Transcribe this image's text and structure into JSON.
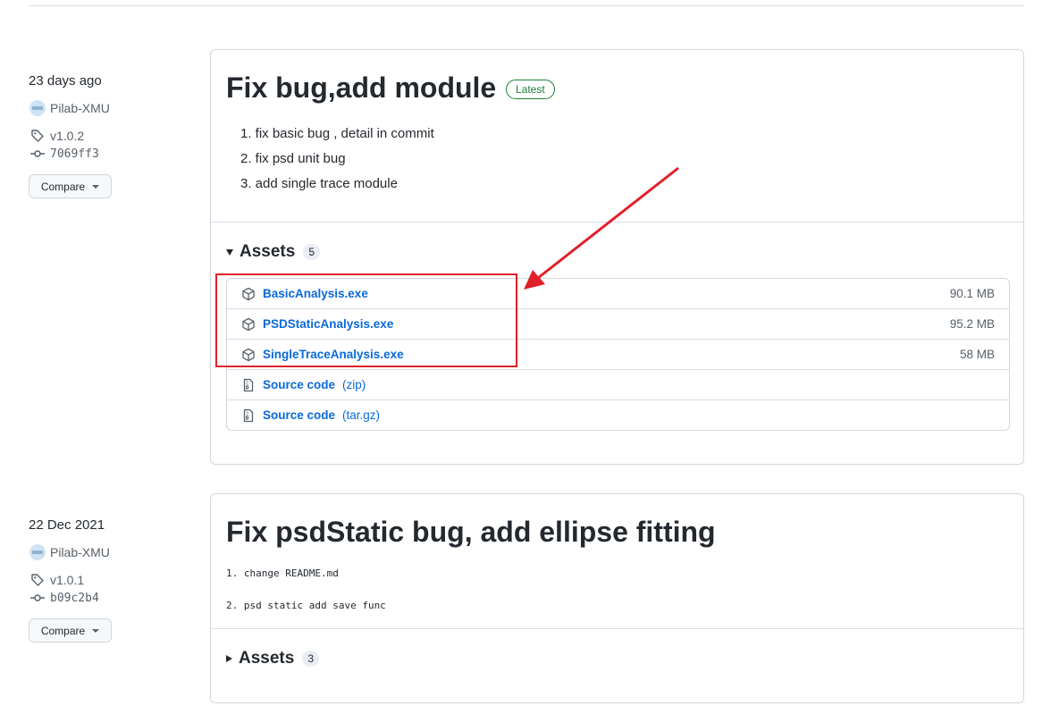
{
  "releases": [
    {
      "date": "23 days ago",
      "author": "Pilab-XMU",
      "tag": "v1.0.2",
      "commit": "7069ff3",
      "compare_label": "Compare",
      "title": "Fix bug,add module",
      "badge": "Latest",
      "notes": [
        "1. fix basic bug , detail in commit",
        "2. fix psd unit bug",
        "3. add single trace module"
      ],
      "assets_label": "Assets",
      "assets_count": "5",
      "assets": [
        {
          "name": "BasicAnalysis.exe",
          "size": "90.1 MB",
          "icon": "package-icon"
        },
        {
          "name": "PSDStaticAnalysis.exe",
          "size": "95.2 MB",
          "icon": "package-icon"
        },
        {
          "name": "SingleTraceAnalysis.exe",
          "size": "58 MB",
          "icon": "package-icon"
        },
        {
          "name": "Source code",
          "suffix": "(zip)",
          "icon": "file-zip-icon"
        },
        {
          "name": "Source code",
          "suffix": "(tar.gz)",
          "icon": "file-zip-icon"
        }
      ]
    },
    {
      "date": "22 Dec 2021",
      "author": "Pilab-XMU",
      "tag": "v1.0.1",
      "commit": "b09c2b4",
      "compare_label": "Compare",
      "title": "Fix psdStatic bug, add ellipse fitting",
      "notes": [
        "1. change README.md",
        "2. psd static add save func"
      ],
      "assets_label": "Assets",
      "assets_count": "3"
    }
  ],
  "colors": {
    "link": "#0969da",
    "latest": "#1a7f37",
    "annotation": "#e0202a"
  }
}
